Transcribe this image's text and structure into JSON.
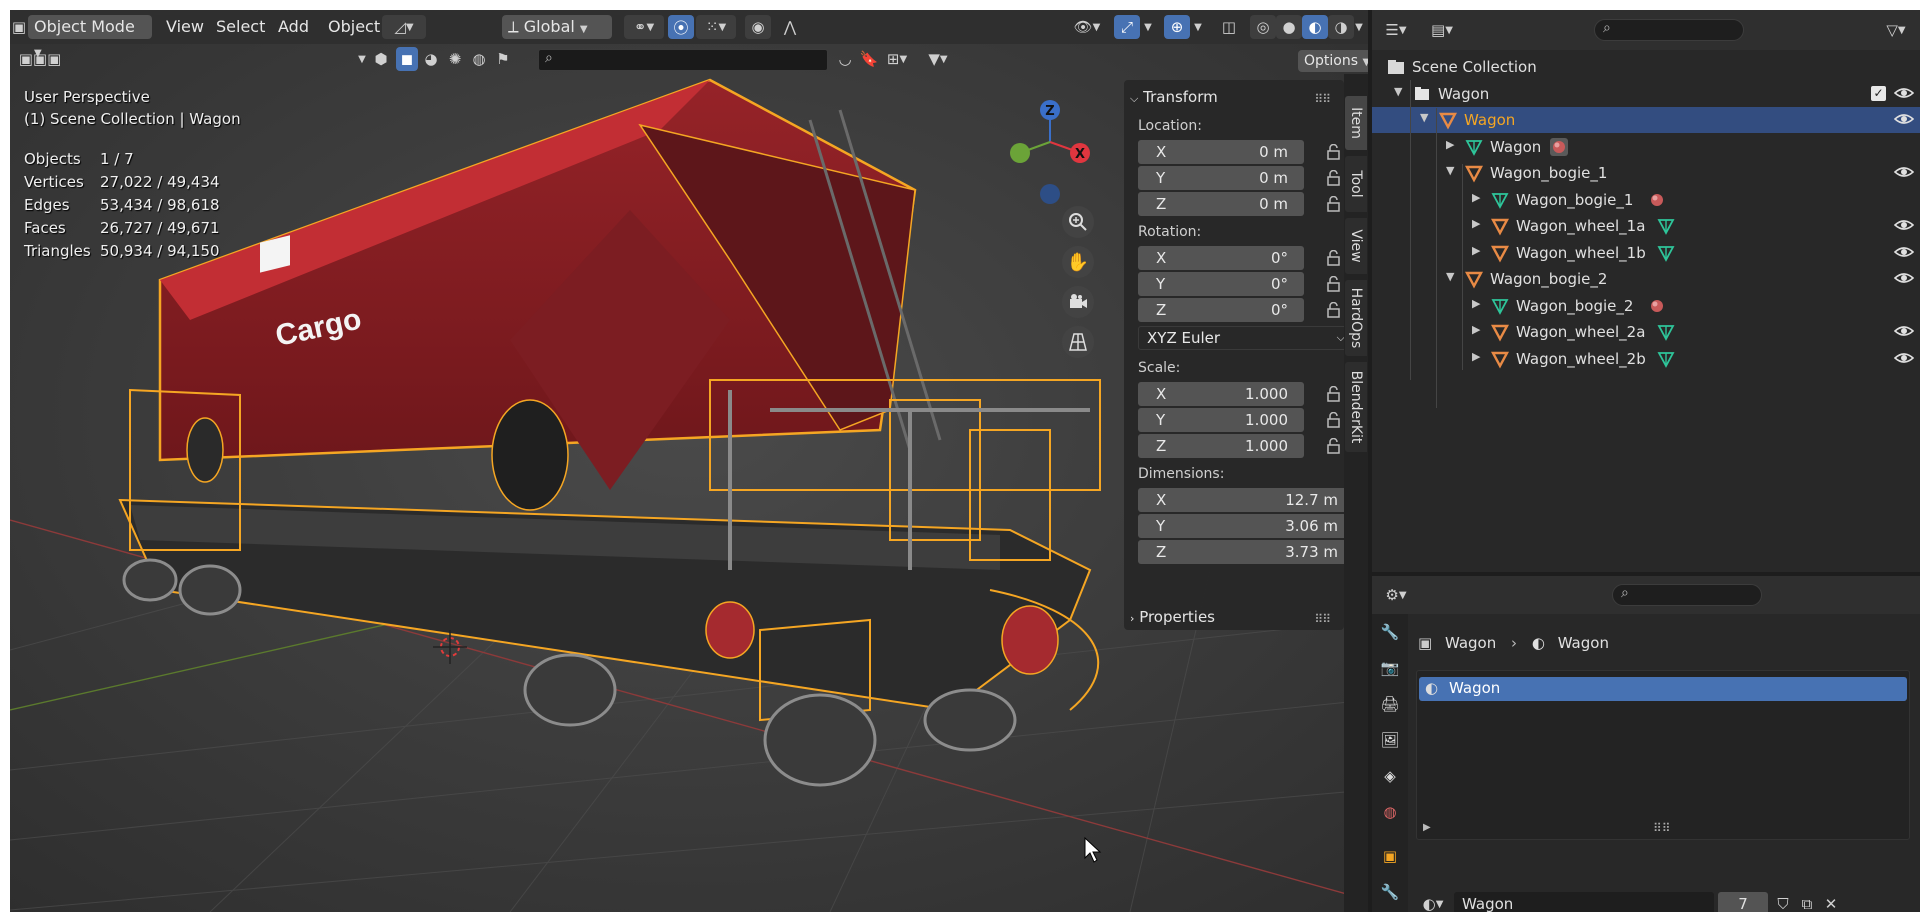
{
  "viewport": {
    "header": {
      "mode": "Object Mode",
      "menus": [
        "View",
        "Select",
        "Add",
        "Object"
      ],
      "orientation": "Global",
      "options_label": "Options"
    },
    "overlay": {
      "perspective": "User Perspective",
      "collection": "(1) Scene Collection | Wagon",
      "stats": [
        {
          "key": "Objects",
          "value": "1 / 7"
        },
        {
          "key": "Vertices",
          "value": "27,022 / 49,434"
        },
        {
          "key": "Edges",
          "value": "53,434 / 98,618"
        },
        {
          "key": "Faces",
          "value": "26,727 / 49,671"
        },
        {
          "key": "Triangles",
          "value": "50,934 / 94,150"
        }
      ],
      "wagon_label": "Cargo",
      "axes": {
        "x": "X",
        "z": "Z"
      }
    },
    "npanel": {
      "transform_title": "Transform",
      "location_label": "Location:",
      "location": [
        {
          "axis": "X",
          "value": "0 m"
        },
        {
          "axis": "Y",
          "value": "0 m"
        },
        {
          "axis": "Z",
          "value": "0 m"
        }
      ],
      "rotation_label": "Rotation:",
      "rotation": [
        {
          "axis": "X",
          "value": "0°"
        },
        {
          "axis": "Y",
          "value": "0°"
        },
        {
          "axis": "Z",
          "value": "0°"
        }
      ],
      "rotation_mode": "XYZ Euler",
      "scale_label": "Scale:",
      "scale": [
        {
          "axis": "X",
          "value": "1.000"
        },
        {
          "axis": "Y",
          "value": "1.000"
        },
        {
          "axis": "Z",
          "value": "1.000"
        }
      ],
      "dimensions_label": "Dimensions:",
      "dimensions": [
        {
          "axis": "X",
          "value": "12.7 m"
        },
        {
          "axis": "Y",
          "value": "3.06 m"
        },
        {
          "axis": "Z",
          "value": "3.73 m"
        }
      ],
      "properties_title": "Properties"
    },
    "tabs": [
      "Item",
      "Tool",
      "View",
      "HardOps",
      "BlenderKit"
    ]
  },
  "outliner": {
    "rows": [
      {
        "label": "Scene Collection",
        "indent": 0,
        "icon": "scene-collection-icon"
      },
      {
        "label": "Wagon",
        "indent": 1,
        "icon": "collection-icon",
        "tri": "▼",
        "check": true
      },
      {
        "label": "Wagon",
        "indent": 2,
        "icon": "empty-icon",
        "tri": "▼",
        "selected": true,
        "eye": true
      },
      {
        "label": "Wagon",
        "indent": 3,
        "icon": "mesh-icon",
        "tri": "▶",
        "material": true
      },
      {
        "label": "Wagon_bogie_1",
        "indent": 3,
        "icon": "empty-icon",
        "tri": "▼",
        "eye": true
      },
      {
        "label": "Wagon_bogie_1",
        "indent": 4,
        "icon": "mesh-icon",
        "tri": "▶",
        "material": true
      },
      {
        "label": "Wagon_wheel_1a",
        "indent": 4,
        "icon": "empty-icon",
        "tri": "▶",
        "mesh_child": true,
        "eye": true
      },
      {
        "label": "Wagon_wheel_1b",
        "indent": 4,
        "icon": "empty-icon",
        "tri": "▶",
        "mesh_child": true,
        "eye": true
      },
      {
        "label": "Wagon_bogie_2",
        "indent": 3,
        "icon": "empty-icon",
        "tri": "▼",
        "eye": true
      },
      {
        "label": "Wagon_bogie_2",
        "indent": 4,
        "icon": "mesh-icon",
        "tri": "▶",
        "material": true
      },
      {
        "label": "Wagon_wheel_2a",
        "indent": 4,
        "icon": "empty-icon",
        "tri": "▶",
        "mesh_child": true,
        "eye": true
      },
      {
        "label": "Wagon_wheel_2b",
        "indent": 4,
        "icon": "empty-icon",
        "tri": "▶",
        "mesh_child": true,
        "eye": true
      }
    ]
  },
  "properties": {
    "breadcrumb": {
      "object": "Wagon",
      "material": "Wagon"
    },
    "material_slot": "Wagon",
    "material_name": "Wagon",
    "user_count": "7"
  },
  "colors": {
    "accent": "#4772b3",
    "selection_outline": "#f5a623",
    "wagon_red": "#a5262b",
    "empty_icon": "#e88a45",
    "mesh_icon": "#2ec59a"
  }
}
